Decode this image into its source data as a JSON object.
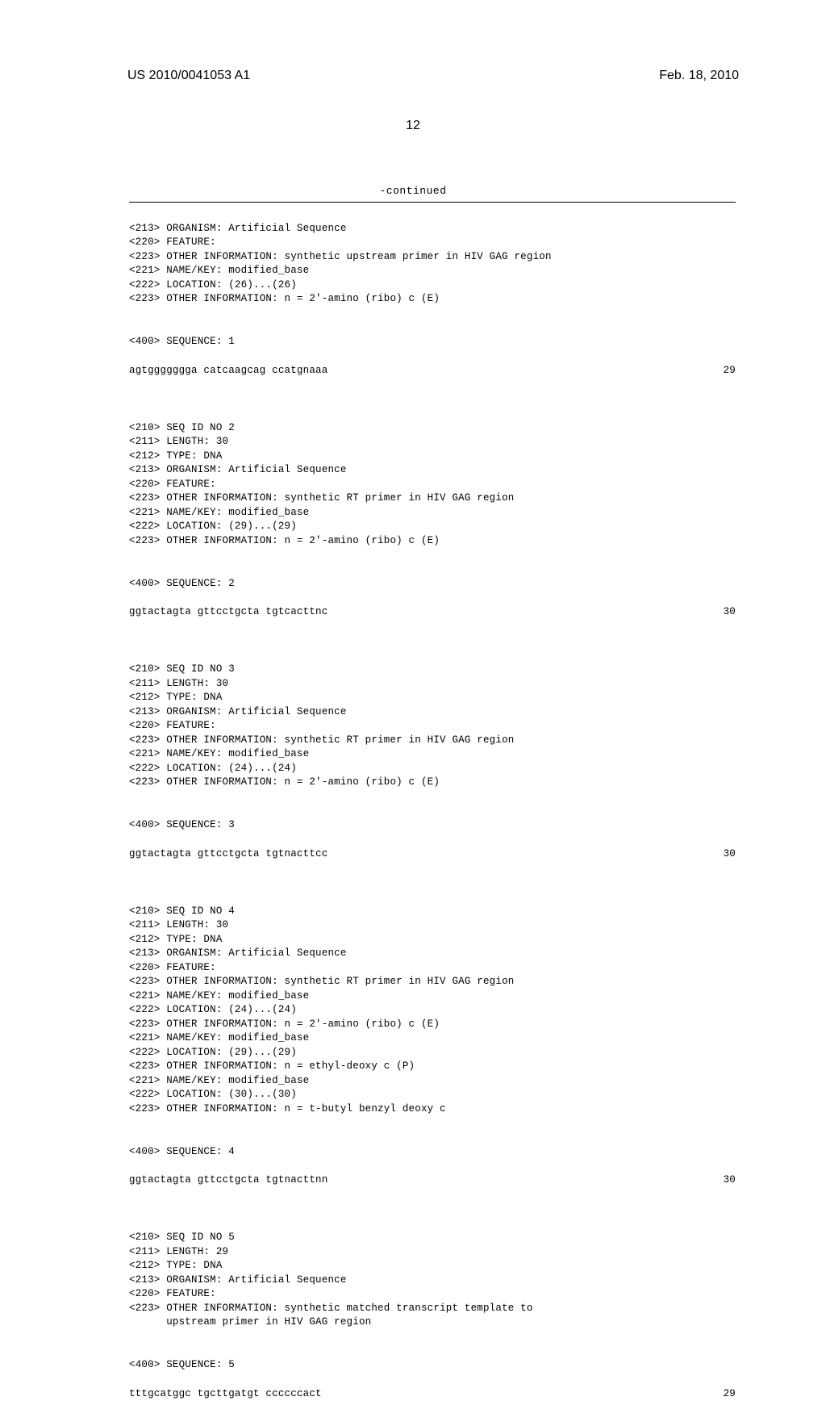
{
  "header": {
    "pub_number": "US 2010/0041053 A1",
    "pub_date": "Feb. 18, 2010"
  },
  "page_number": "12",
  "continued_label": "-continued",
  "sequences": [
    {
      "lines": [
        "<213> ORGANISM: Artificial Sequence",
        "<220> FEATURE:",
        "<223> OTHER INFORMATION: synthetic upstream primer in HIV GAG region",
        "<221> NAME/KEY: modified_base",
        "<222> LOCATION: (26)...(26)",
        "<223> OTHER INFORMATION: n = 2'-amino (ribo) c (E)"
      ],
      "seq_label": "<400> SEQUENCE: 1",
      "seq_data": "agtggggggga catcaagcag ccatgnaaa",
      "seq_num": "29"
    },
    {
      "lines": [
        "<210> SEQ ID NO 2",
        "<211> LENGTH: 30",
        "<212> TYPE: DNA",
        "<213> ORGANISM: Artificial Sequence",
        "<220> FEATURE:",
        "<223> OTHER INFORMATION: synthetic RT primer in HIV GAG region",
        "<221> NAME/KEY: modified_base",
        "<222> LOCATION: (29)...(29)",
        "<223> OTHER INFORMATION: n = 2'-amino (ribo) c (E)"
      ],
      "seq_label": "<400> SEQUENCE: 2",
      "seq_data": "ggtactagta gttcctgcta tgtcacttnc",
      "seq_num": "30"
    },
    {
      "lines": [
        "<210> SEQ ID NO 3",
        "<211> LENGTH: 30",
        "<212> TYPE: DNA",
        "<213> ORGANISM: Artificial Sequence",
        "<220> FEATURE:",
        "<223> OTHER INFORMATION: synthetic RT primer in HIV GAG region",
        "<221> NAME/KEY: modified_base",
        "<222> LOCATION: (24)...(24)",
        "<223> OTHER INFORMATION: n = 2'-amino (ribo) c (E)"
      ],
      "seq_label": "<400> SEQUENCE: 3",
      "seq_data": "ggtactagta gttcctgcta tgtnacttcc",
      "seq_num": "30"
    },
    {
      "lines": [
        "<210> SEQ ID NO 4",
        "<211> LENGTH: 30",
        "<212> TYPE: DNA",
        "<213> ORGANISM: Artificial Sequence",
        "<220> FEATURE:",
        "<223> OTHER INFORMATION: synthetic RT primer in HIV GAG region",
        "<221> NAME/KEY: modified_base",
        "<222> LOCATION: (24)...(24)",
        "<223> OTHER INFORMATION: n = 2'-amino (ribo) c (E)",
        "<221> NAME/KEY: modified_base",
        "<222> LOCATION: (29)...(29)",
        "<223> OTHER INFORMATION: n = ethyl-deoxy c (P)",
        "<221> NAME/KEY: modified_base",
        "<222> LOCATION: (30)...(30)",
        "<223> OTHER INFORMATION: n = t-butyl benzyl deoxy c"
      ],
      "seq_label": "<400> SEQUENCE: 4",
      "seq_data": "ggtactagta gttcctgcta tgtnacttnn",
      "seq_num": "30"
    },
    {
      "lines": [
        "<210> SEQ ID NO 5",
        "<211> LENGTH: 29",
        "<212> TYPE: DNA",
        "<213> ORGANISM: Artificial Sequence",
        "<220> FEATURE:",
        "<223> OTHER INFORMATION: synthetic matched transcript template to",
        "      upstream primer in HIV GAG region"
      ],
      "seq_label": "<400> SEQUENCE: 5",
      "seq_data": "tttgcatggc tgcttgatgt ccccccact",
      "seq_num": "29"
    }
  ]
}
